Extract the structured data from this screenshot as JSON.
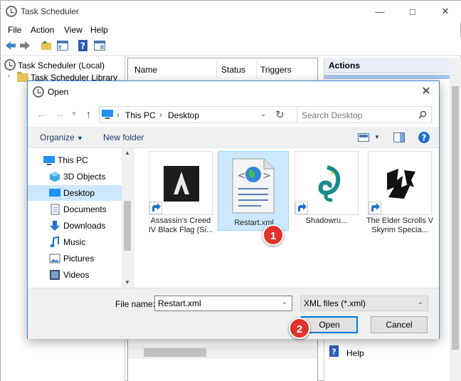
{
  "window": {
    "title": "Task Scheduler",
    "menu": [
      "File",
      "Action",
      "View",
      "Help"
    ],
    "tree": [
      "Task Scheduler (Local)",
      "Task Scheduler Library"
    ],
    "columns": [
      "Name",
      "Status",
      "Triggers"
    ],
    "actions_header": "Actions",
    "actions_help": "Help"
  },
  "dialog": {
    "title": "Open",
    "breadcrumb": [
      "This PC",
      "Desktop"
    ],
    "search_placeholder": "Search Desktop",
    "organize_label": "Organize",
    "new_folder_label": "New folder",
    "nav_items": [
      {
        "label": "This PC",
        "icon": "computer-icon"
      },
      {
        "label": "3D Objects",
        "icon": "cube-icon"
      },
      {
        "label": "Desktop",
        "icon": "desktop-icon",
        "selected": true
      },
      {
        "label": "Documents",
        "icon": "document-icon"
      },
      {
        "label": "Downloads",
        "icon": "download-icon"
      },
      {
        "label": "Music",
        "icon": "music-icon"
      },
      {
        "label": "Pictures",
        "icon": "picture-icon"
      },
      {
        "label": "Videos",
        "icon": "video-icon"
      }
    ],
    "files": [
      {
        "name": "Assassin's Creed IV Black Flag (Si...",
        "icon": "game-shortcut-icon"
      },
      {
        "name": "Restart.xml",
        "icon": "xml-file-icon",
        "selected": true
      },
      {
        "name": "Shadowru...",
        "icon": "game-shortcut-icon"
      },
      {
        "name": "The Elder Scrolls V Skyrim Specia...",
        "icon": "game-shortcut-icon"
      }
    ],
    "file_name_label": "File name:",
    "file_name_value": "Restart.xml",
    "file_type_value": "XML files (*.xml)",
    "open_label": "Open",
    "cancel_label": "Cancel"
  },
  "markers": [
    "1",
    "2"
  ],
  "colors": {
    "accent": "#0078d7",
    "selection": "#cce8ff",
    "marker": "#e0332c"
  }
}
